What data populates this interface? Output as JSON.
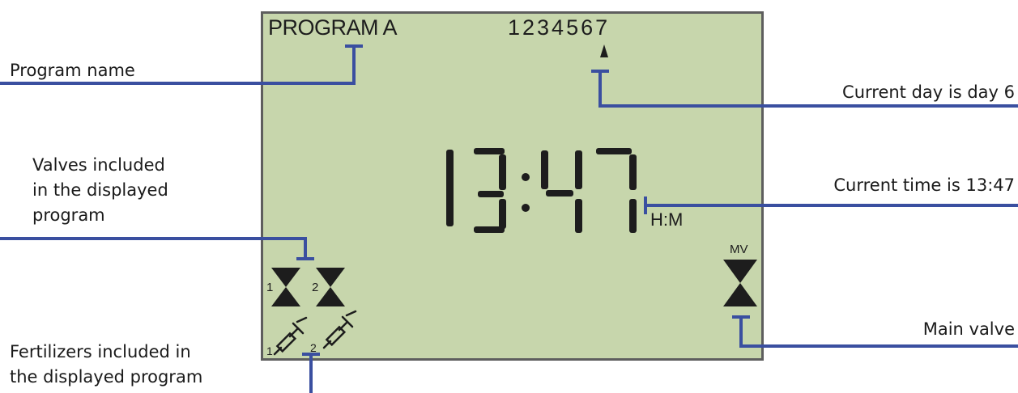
{
  "lcd": {
    "program_label": "PROGRAM A",
    "days": "1234567",
    "time": "13:47",
    "time_unit": "H:M",
    "main_valve_label": "MV",
    "valve_numbers": [
      "1",
      "2"
    ],
    "fertilizer_numbers": [
      "1",
      "2"
    ]
  },
  "callouts": {
    "program_name": "Program name",
    "current_day": "Current day is day 6",
    "valves": [
      "Valves included",
      "in the displayed",
      "program"
    ],
    "current_time": "Current time is 13:47",
    "main_valve": "Main valve",
    "fertilizers": [
      "Fertilizers included in",
      "the displayed program"
    ]
  },
  "colors": {
    "lcd_background": "#c7d6ac",
    "lcd_border": "#5e5e5e",
    "segment": "#1d1d1d",
    "callout_line": "#3a4fa0"
  },
  "icons": [
    "valve-icon",
    "syringe-icon",
    "day-pointer-icon"
  ]
}
